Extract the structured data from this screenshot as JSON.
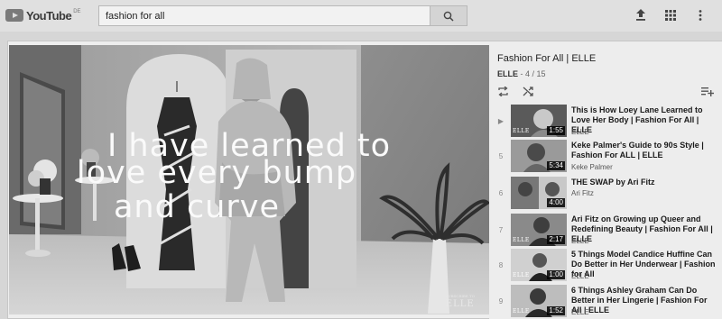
{
  "header": {
    "logo_text": "YouTube",
    "logo_region": "DE",
    "search_value": "fashion for all"
  },
  "icons": {
    "logo": "youtube-play-icon",
    "search": "search-icon",
    "upload": "upload-icon",
    "apps": "apps-grid-icon",
    "more": "more-vert-icon",
    "loop": "loop-icon",
    "shuffle": "shuffle-icon",
    "save_playlist": "playlist-add-icon"
  },
  "video": {
    "caption_lines": [
      "I have learned to",
      "love every bump",
      "and curve"
    ],
    "watermark": "ELLE",
    "watermark_small": "SUBSCRIBE TO"
  },
  "playlist": {
    "title": "Fashion For All | ELLE",
    "channel": "ELLE",
    "position": "- 4 / 15",
    "items": [
      {
        "index": "▶",
        "title": "This is How Loey Lane Learned to Love Her Body | Fashion For All | ELLE",
        "channel": "ELLE",
        "duration": "1:55",
        "badge": "ELLE"
      },
      {
        "index": "5",
        "title": "Keke Palmer's Guide to 90s Style | Fashion For ALL | ELLE",
        "channel": "Keke Palmer",
        "duration": "5:34",
        "badge": ""
      },
      {
        "index": "6",
        "title": "THE SWAP by Ari Fitz",
        "channel": "Ari Fitz",
        "duration": "4:00",
        "badge": ""
      },
      {
        "index": "7",
        "title": "Ari Fitz on Growing up Queer and Redefining Beauty | Fashion For All | ELLE",
        "channel": "ELLE",
        "duration": "2:17",
        "badge": "ELLE"
      },
      {
        "index": "8",
        "title": "5 Things Model Candice Huffine Can Do Better in Her Underwear | Fashion for All",
        "channel": "ELLE",
        "duration": "1:00",
        "badge": "ELLE"
      },
      {
        "index": "9",
        "title": "6 Things Ashley Graham Can Do Better in Her Lingerie | Fashion For All | ELLE",
        "channel": "ELLE",
        "duration": "1:52",
        "badge": "ELLE"
      }
    ]
  }
}
